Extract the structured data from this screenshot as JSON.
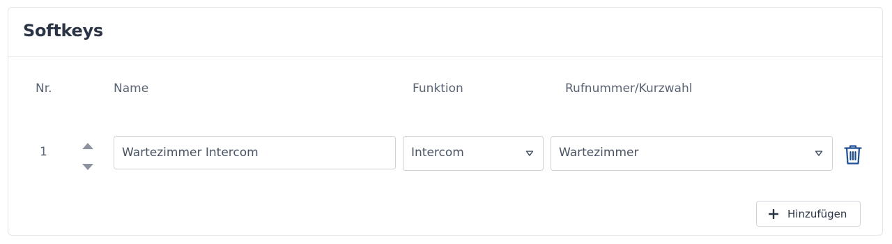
{
  "card": {
    "title": "Softkeys"
  },
  "table": {
    "headers": {
      "nr": "Nr.",
      "name": "Name",
      "funktion": "Funktion",
      "nummer": "Rufnummer/Kurzwahl"
    },
    "rows": [
      {
        "nr": "1",
        "name": "Wartezimmer Intercom",
        "funktion": "Intercom",
        "nummer": "Wartezimmer"
      }
    ]
  },
  "actions": {
    "add_label": "Hinzufügen"
  },
  "icons": {
    "sort_up": "caret-up-icon",
    "sort_down": "caret-down-icon",
    "dropdown": "chevron-down-icon",
    "delete": "trash-icon",
    "add": "plus-icon"
  },
  "colors": {
    "title": "#2b3445",
    "text": "#5b6474",
    "border": "#cfd3d9",
    "delete_icon": "#1f4f93"
  }
}
